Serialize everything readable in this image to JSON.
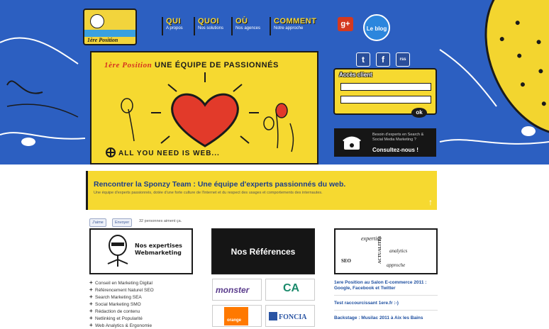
{
  "logo": {
    "text": "1ère Position"
  },
  "nav": [
    {
      "title": "QUI",
      "subtitle": "A propos"
    },
    {
      "title": "QUOI",
      "subtitle": "Nos solutions"
    },
    {
      "title": "OÙ",
      "subtitle": "Nos agences"
    },
    {
      "title": "COMMENT",
      "subtitle": "Notre approche"
    }
  ],
  "header": {
    "gplus": "g+",
    "blog": "Le blog"
  },
  "hero": {
    "brand": "1ère Position",
    "title": "UNE ÉQUIPE DE PASSIONNÉS",
    "tagline": "ALL YOU NEED IS WEB..."
  },
  "social": {
    "twitter": "t",
    "facebook": "f",
    "rss": "rss"
  },
  "client": {
    "label": "Accès client",
    "ok": "ok"
  },
  "experts": {
    "question": "Besoin d'experts en Search & Social Media Marketing ?",
    "cta": "Consultez-nous !"
  },
  "banner": {
    "heading": "Rencontrer la Sponzy Team : Une équipe d'experts passionnés du web.",
    "text": "Une équipe d'experts passionnés, dotée d'une forte culture de l'Internet et du respect des usages et comportements des internautes.",
    "arrow": "↑"
  },
  "facebook": {
    "like": "J'aime",
    "send": "Envoyer",
    "count": "32 personnes aiment ça."
  },
  "cards": {
    "expertises": "Nos expertises Webmarketing",
    "references": "Nos Références",
    "words": [
      "expertise",
      "analytics",
      "SEO",
      "approche",
      "ACTUALITÉS"
    ]
  },
  "expertises_list": [
    "Conseil en Marketing Digital",
    "Référencement Naturel SEO",
    "Search Marketing SEA",
    "Social Marketing SMO",
    "Rédaction de contenu",
    "Netlinking et Popularité",
    "Web Analytics & Ergonomie"
  ],
  "references_logos": [
    "monster",
    "CA",
    "orange",
    "FONCIA"
  ],
  "news": [
    "1ere Position au Salon E-commerce 2011 : Google, Facebook et Twitter",
    "Test raccourcissant 1ere.fr :-)",
    "Backstage : Musilac 2011 à Aix les Bains"
  ],
  "colors": {
    "blue": "#2c5fc1",
    "yellow": "#f6d930",
    "dark": "#1b1b1b"
  }
}
